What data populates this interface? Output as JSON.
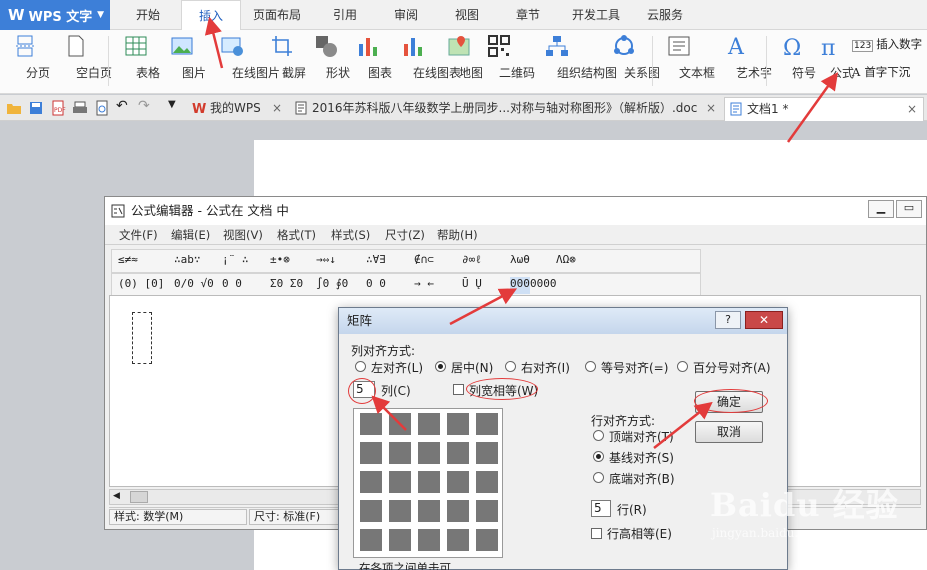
{
  "app": {
    "logo_text": "WPS 文字"
  },
  "menu_tabs": [
    "开始",
    "插入",
    "页面布局",
    "引用",
    "审阅",
    "视图",
    "章节",
    "开发工具",
    "云服务"
  ],
  "ribbon": {
    "items": [
      "分页",
      "空白页",
      "表格",
      "图片",
      "在线图片",
      "截屏",
      "形状",
      "图表",
      "在线图表",
      "地图",
      "二维码",
      "组织结构图",
      "关系图",
      "文本框",
      "艺术字",
      "符号",
      "公式"
    ],
    "right_items": [
      "插入数字",
      "首字下沉"
    ]
  },
  "doc_tabs": [
    {
      "label": "我的WPS"
    },
    {
      "label": "2016年苏科版八年级数学上册同步...对称与轴对称图形》（解析版）.doc"
    },
    {
      "label": "文档1 *"
    }
  ],
  "equation_editor": {
    "title": "公式编辑器 - 公式在 文档 中",
    "menus": [
      "文件(F)",
      "编辑(E)",
      "视图(V)",
      "格式(T)",
      "样式(S)",
      "尺寸(Z)",
      "帮助(H)"
    ],
    "toolbar_row1": [
      "≤≠≈",
      "∴ab∵",
      "¡¨ ∴",
      "±•⊗",
      "→⇔↓",
      "∴∀∃",
      "∉∩⊂",
      "∂∞ℓ",
      "λωθ",
      "ΛΩ⊗"
    ],
    "toolbar_row2": [
      "(0) [0]",
      "0/0 √0",
      "0 0",
      "Σ0 Σ0",
      "∫0 ∮0",
      "0 0",
      "→ ←",
      "Ū Ų",
      "000",
      "0000"
    ],
    "status_style": "样式: 数学(M)",
    "status_size": "尺寸: 标准(F)"
  },
  "matrix_dialog": {
    "title": "矩阵",
    "help_label": "?",
    "close_label": "✕",
    "col_align_label": "列对齐方式:",
    "col_align_options": [
      "左对齐(L)",
      "居中(N)",
      "右对齐(I)",
      "等号对齐(=)",
      "百分号对齐(A)"
    ],
    "col_align_selected": 1,
    "columns_value": "5",
    "columns_label": "列(C)",
    "equal_width_label": "列宽相等(W)",
    "ok_label": "确定",
    "cancel_label": "取消",
    "row_align_label": "行对齐方式:",
    "row_align_options": [
      "顶端对齐(T)",
      "基线对齐(S)",
      "底端对齐(B)"
    ],
    "row_align_selected": 1,
    "rows_value": "5",
    "rows_label": "行(R)",
    "equal_height_label": "行高相等(E)",
    "hint_text": "在各项之间单击可"
  },
  "watermark": {
    "brand": "Baidu 经验",
    "url": "jingyan.baidu.com"
  },
  "colors": {
    "accent": "#3d7fd8",
    "annotation": "#e33b3b"
  }
}
